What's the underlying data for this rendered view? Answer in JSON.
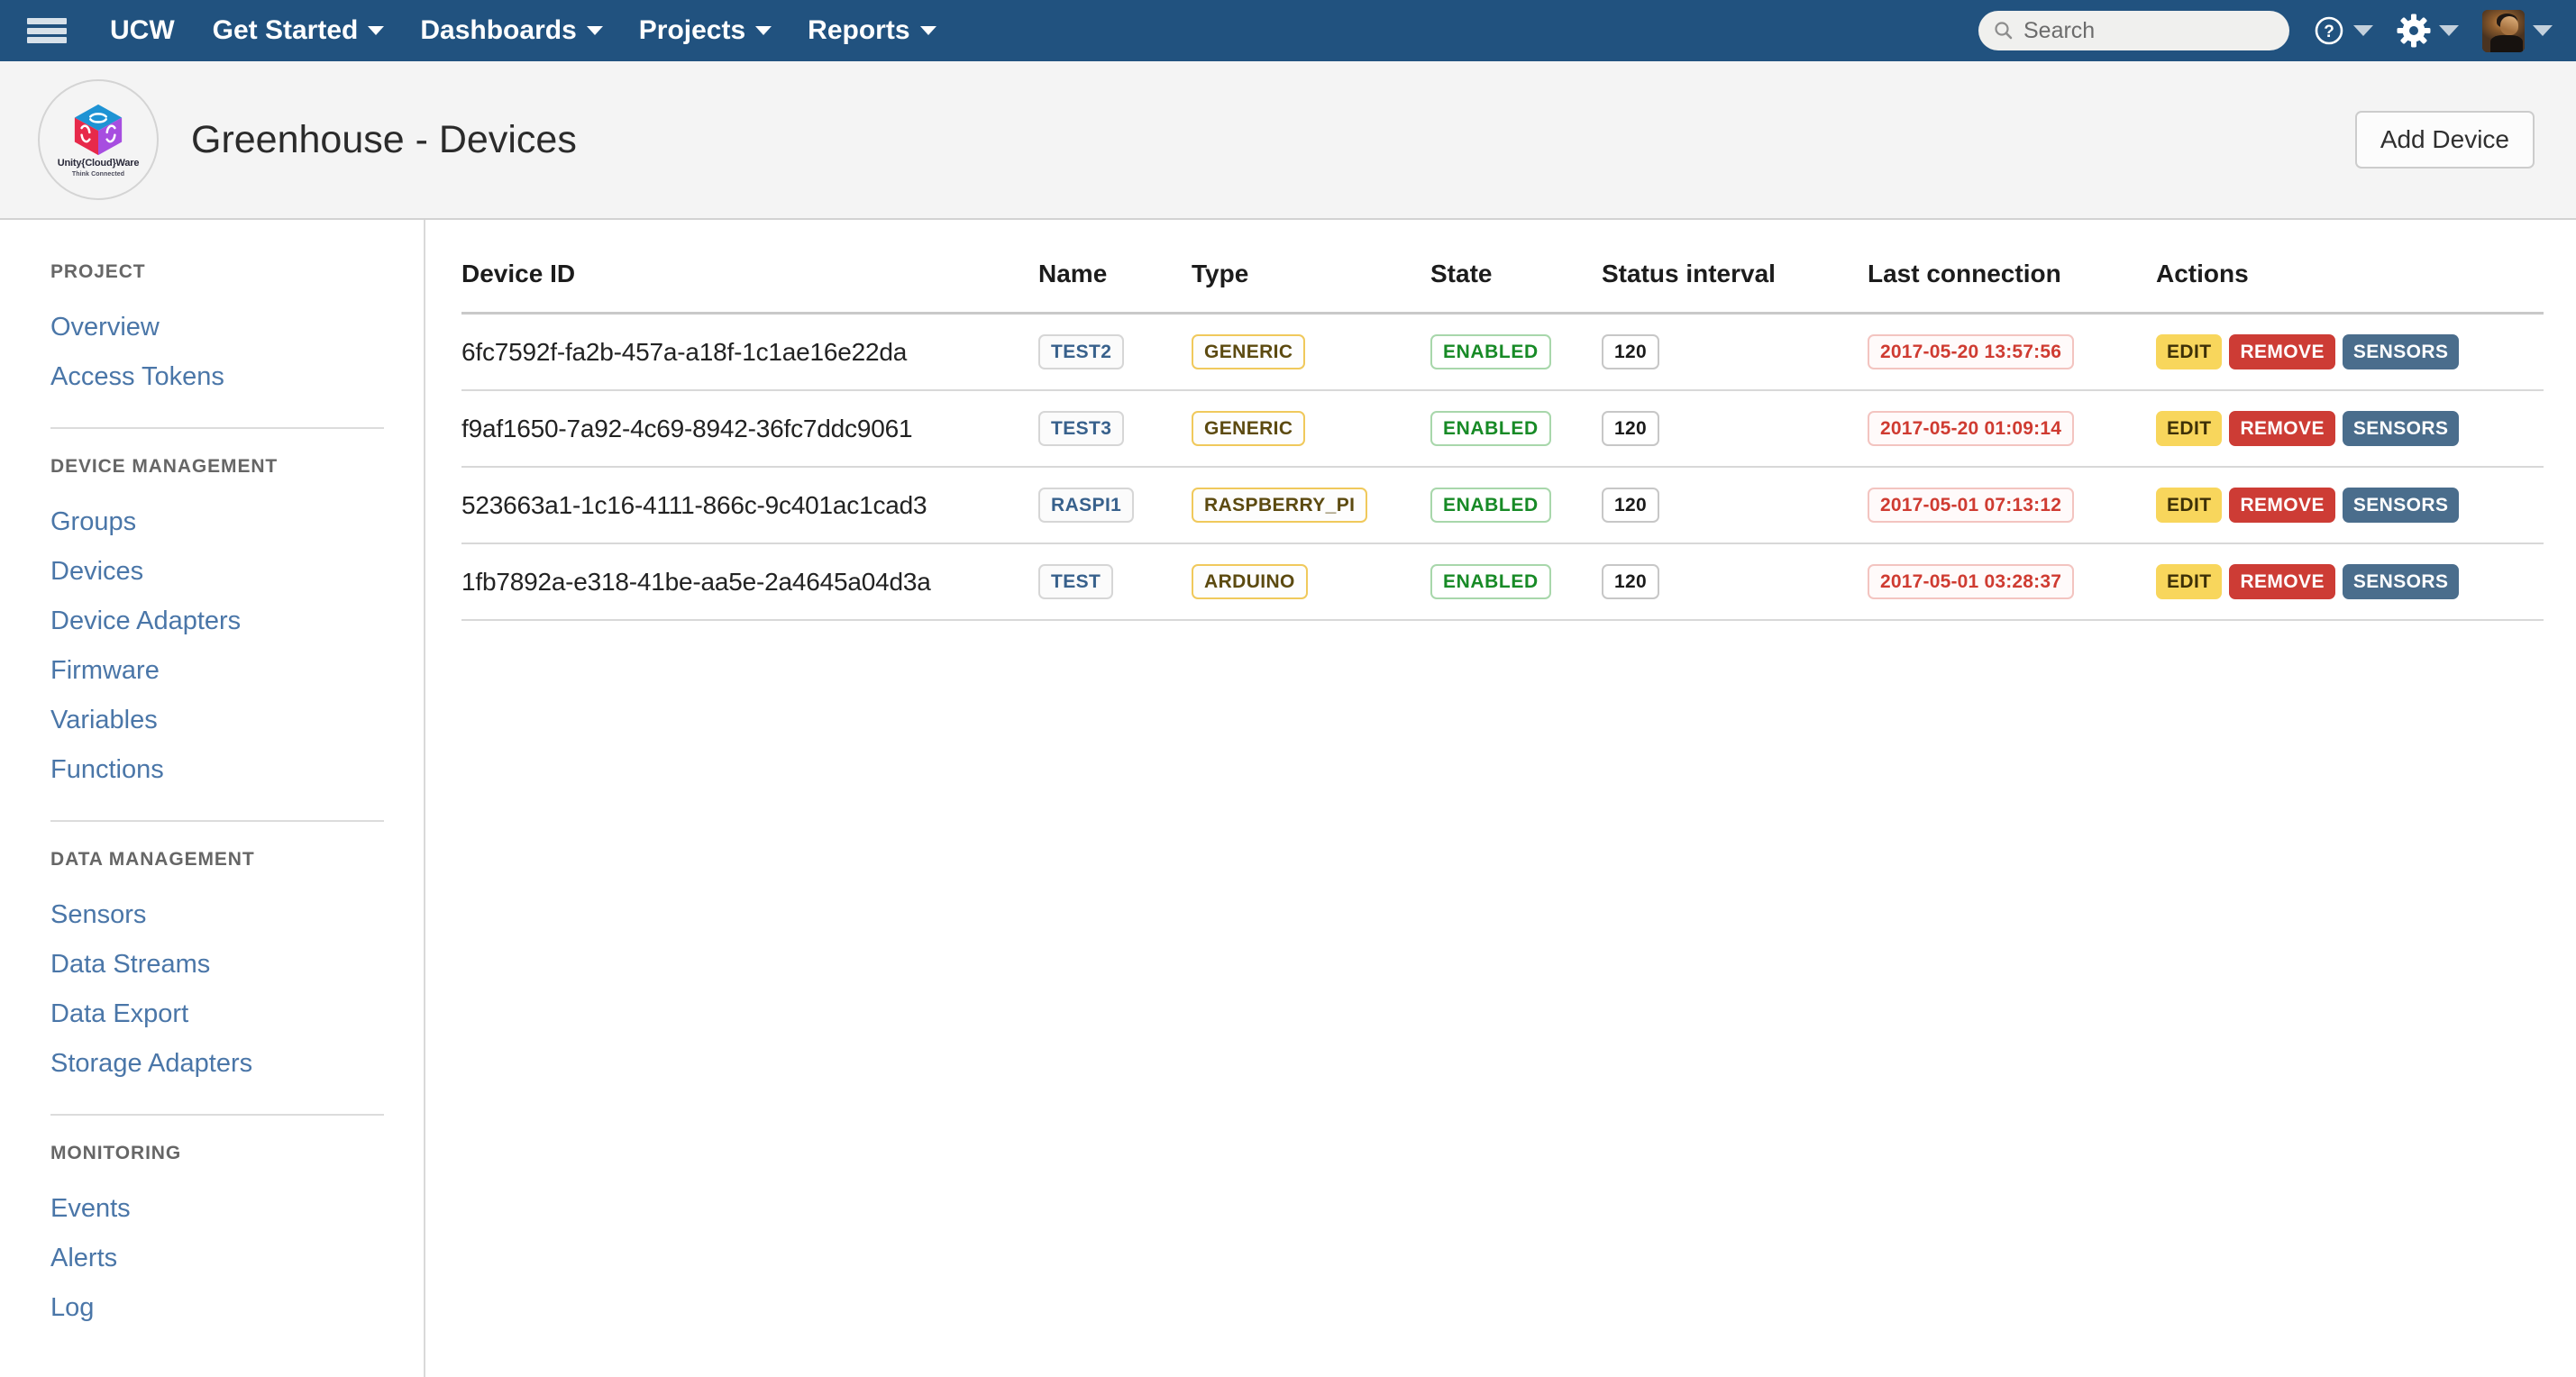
{
  "navbar": {
    "menu_icon": "hamburger-icon",
    "brand": "UCW",
    "items": [
      {
        "label": "Get Started",
        "has_caret": true
      },
      {
        "label": "Dashboards",
        "has_caret": true
      },
      {
        "label": "Projects",
        "has_caret": true
      },
      {
        "label": "Reports",
        "has_caret": true
      }
    ],
    "search": {
      "placeholder": "Search",
      "value": "",
      "icon": "search-icon"
    },
    "help": {
      "icon": "question-circle-icon",
      "has_caret": true
    },
    "settings": {
      "icon": "gear-icon",
      "has_caret": true
    },
    "user": {
      "icon": "avatar",
      "has_caret": true
    },
    "background_color": "#21527f"
  },
  "header": {
    "logo": {
      "name": "Unity{Cloud}Ware",
      "tagline": "Think Connected",
      "icon": "isometric-cube-logo",
      "colors": {
        "top": "#1e93d4",
        "left": "#e7294a",
        "right": "#a74ee0"
      }
    },
    "title": "Greenhouse - Devices",
    "add_device_label": "Add Device",
    "background_color": "#f4f4f4"
  },
  "sidebar": {
    "groups": [
      {
        "title": "PROJECT",
        "links": [
          {
            "label": "Overview"
          },
          {
            "label": "Access Tokens"
          }
        ]
      },
      {
        "title": "DEVICE MANAGEMENT",
        "links": [
          {
            "label": "Groups"
          },
          {
            "label": "Devices"
          },
          {
            "label": "Device Adapters"
          },
          {
            "label": "Firmware"
          },
          {
            "label": "Variables"
          },
          {
            "label": "Functions"
          }
        ]
      },
      {
        "title": "DATA MANAGEMENT",
        "links": [
          {
            "label": "Sensors"
          },
          {
            "label": "Data Streams"
          },
          {
            "label": "Data Export"
          },
          {
            "label": "Storage Adapters"
          }
        ]
      },
      {
        "title": "MONITORING",
        "links": [
          {
            "label": "Events"
          },
          {
            "label": "Alerts"
          },
          {
            "label": "Log"
          }
        ]
      }
    ],
    "link_color": "#4a76a8"
  },
  "table": {
    "columns": [
      "Device ID",
      "Name",
      "Type",
      "State",
      "Status interval",
      "Last connection",
      "Actions"
    ],
    "action_labels": {
      "edit": "EDIT",
      "remove": "REMOVE",
      "sensors": "SENSORS"
    },
    "action_colors": {
      "edit": "#f8d65c",
      "remove": "#cd3c35",
      "sensors": "#4a6d8c"
    },
    "rows": [
      {
        "device_id": "6fc7592f-fa2b-457a-a18f-1c1ae16e22da",
        "name": "TEST2",
        "type": "GENERIC",
        "state": "ENABLED",
        "status_interval": "120",
        "last_connection": "2017-05-20 13:57:56"
      },
      {
        "device_id": "f9af1650-7a92-4c69-8942-36fc7ddc9061",
        "name": "TEST3",
        "type": "GENERIC",
        "state": "ENABLED",
        "status_interval": "120",
        "last_connection": "2017-05-20 01:09:14"
      },
      {
        "device_id": "523663a1-1c16-4111-866c-9c401ac1cad3",
        "name": "RASPI1",
        "type": "RASPBERRY_PI",
        "state": "ENABLED",
        "status_interval": "120",
        "last_connection": "2017-05-01 07:13:12"
      },
      {
        "device_id": "1fb7892a-e318-41be-aa5e-2a4645a04d3a",
        "name": "TEST",
        "type": "ARDUINO",
        "state": "ENABLED",
        "status_interval": "120",
        "last_connection": "2017-05-01 03:28:37"
      }
    ]
  }
}
